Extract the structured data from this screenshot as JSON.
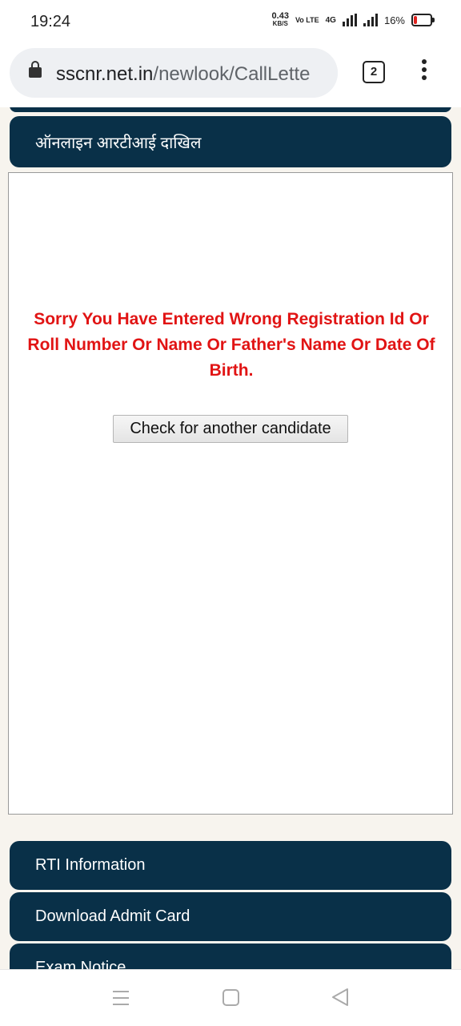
{
  "status_bar": {
    "time": "19:24",
    "net_speed_value": "0.43",
    "net_speed_unit": "KB/S",
    "volte": "Vo LTE",
    "network": "4G",
    "battery": "16%"
  },
  "browser": {
    "url_domain": "sscnr.net.in",
    "url_path": "/newlook/CallLette",
    "tab_count": "2"
  },
  "page": {
    "nav_top": "ऑनलाइन आरटीआई दाखिल",
    "error_message": "Sorry You Have Entered Wrong Registration Id Or Roll Number Or Name Or Father's Name Or Date Of Birth.",
    "check_button": "Check for another candidate",
    "nav_items": [
      "RTI Information",
      "Download Admit Card",
      "Exam Notice"
    ]
  },
  "colors": {
    "nav_strip": "#093048",
    "error_text": "#e11414"
  },
  "icons": [
    "lock-icon",
    "tabs-icon",
    "more-vert-icon",
    "menu-icon",
    "home-icon",
    "back-icon"
  ]
}
